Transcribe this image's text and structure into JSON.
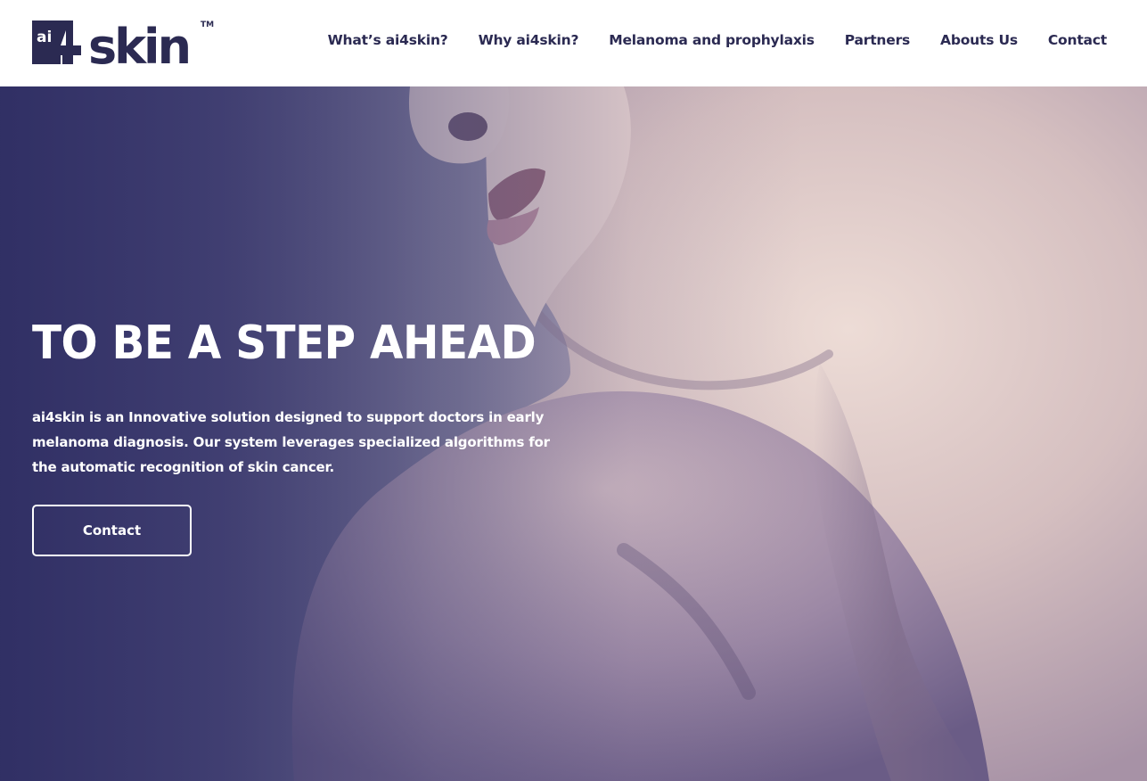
{
  "brand": {
    "logo_prefix": "ai",
    "logo_digit": "4",
    "logo_word": "skin",
    "logo_trademark": "TM",
    "color_primary": "#2b2a52"
  },
  "nav": {
    "items": [
      {
        "label": "What’s ai4skin?"
      },
      {
        "label": "Why ai4skin?"
      },
      {
        "label": "Melanoma and prophylaxis"
      },
      {
        "label": "Partners"
      },
      {
        "label": "Abouts Us"
      },
      {
        "label": "Contact"
      }
    ]
  },
  "hero": {
    "title": "TO BE A STEP AHEAD",
    "description": "ai4skin is an Innovative solution designed to support doctors in early melanoma diagnosis. Our system leverages specialized algorithms for the automatic recognition of skin cancer.",
    "button_label": "Contact",
    "image_subject": "neck-and-shoulder-photo"
  }
}
